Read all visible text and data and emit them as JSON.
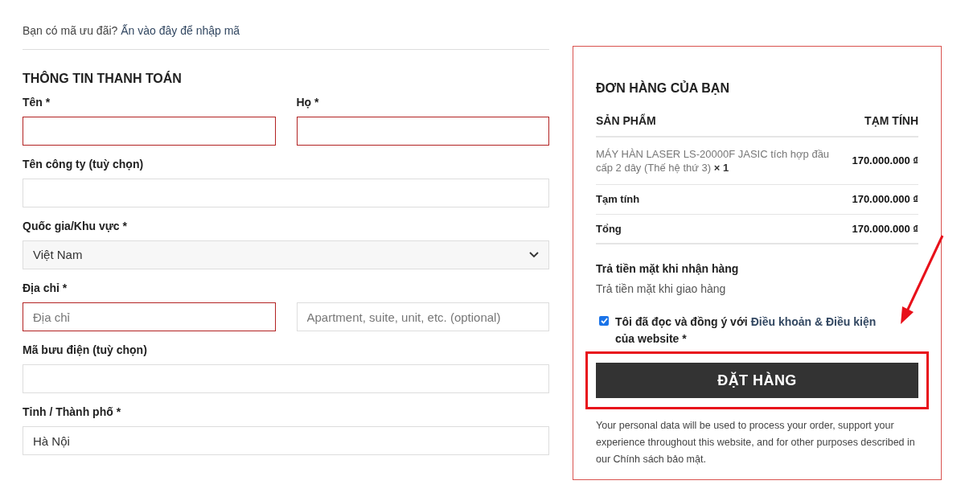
{
  "coupon": {
    "text": "Bạn có mã ưu đãi?",
    "link": "Ấn vào đây để nhập mã"
  },
  "billing": {
    "title": "THÔNG TIN THANH TOÁN",
    "rows": [
      {
        "cols": [
          {
            "label": "Tên *",
            "field": {
              "kind": "text",
              "invalid": true
            }
          },
          {
            "label": "Họ *",
            "field": {
              "kind": "text",
              "invalid": true
            }
          }
        ]
      },
      {
        "cols": [
          {
            "label": "Tên công ty (tuỳ chọn)",
            "field": {
              "kind": "text",
              "invalid": false
            }
          }
        ]
      },
      {
        "cols": [
          {
            "label": "Quốc gia/Khu vực *",
            "field": {
              "kind": "select",
              "invalid": false,
              "value": "Việt Nam"
            }
          }
        ]
      },
      {
        "cols": [
          {
            "label": "Địa chỉ *",
            "field": {
              "kind": "text",
              "invalid": true,
              "placeholder": "Địa chỉ"
            }
          },
          {
            "field": {
              "kind": "text",
              "invalid": false,
              "placeholder": "Apartment, suite, unit, etc. (optional)"
            }
          }
        ]
      },
      {
        "cols": [
          {
            "label": "Mã bưu điện (tuỳ chọn)",
            "field": {
              "kind": "text",
              "invalid": false
            }
          }
        ]
      },
      {
        "cols": [
          {
            "label": "Tỉnh / Thành phố *",
            "field": {
              "kind": "text",
              "invalid": false,
              "value": "Hà Nội"
            }
          }
        ]
      }
    ]
  },
  "order": {
    "title": "ĐƠN HÀNG CỦA BẠN",
    "columns": [
      "SẢN PHẨM",
      "TẠM TÍNH"
    ],
    "items": [
      {
        "name": "MÁY HÀN LASER LS-20000F JASIC tích hợp đầu cấp 2 dây (Thế hệ thứ 3)",
        "qty": "× 1",
        "price": "170.000.000 ₫"
      }
    ],
    "totals": [
      {
        "label": "Tạm tính",
        "value": "170.000.000 ₫"
      },
      {
        "label": "Tổng",
        "value": "170.000.000 ₫"
      }
    ],
    "payment": {
      "title": "Trả tiền mặt khi nhận hàng",
      "description": "Trả tiền mặt khi giao hàng"
    },
    "terms": {
      "checked": true,
      "prefix": "Tôi đã đọc và đồng ý với",
      "link": "Điều khoản & Điều kiện",
      "suffix": "của website *"
    },
    "button": "ĐẶT HÀNG",
    "privacy": {
      "text": "Your personal data will be used to process your order, support your experience throughout this website, and for other purposes described in our",
      "link": "Chính sách bảo mật",
      "end": "."
    }
  }
}
